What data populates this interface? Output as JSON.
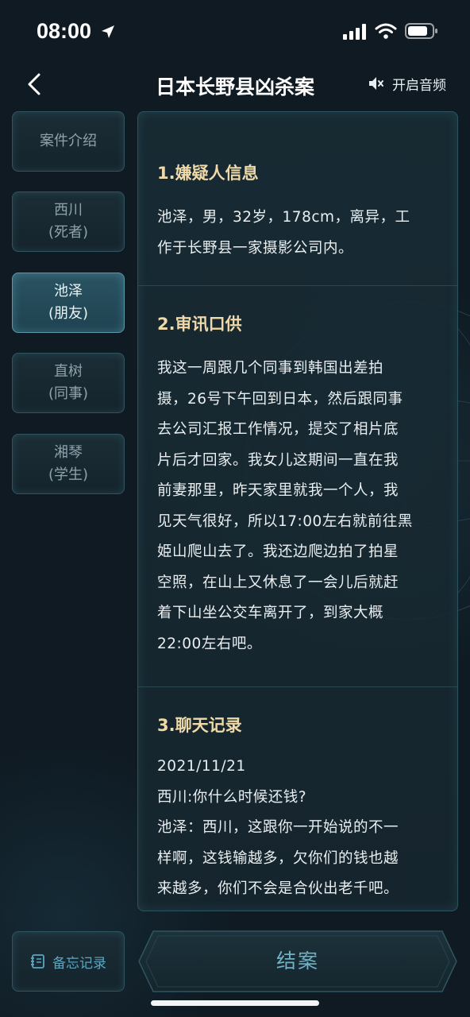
{
  "status_bar": {
    "time": "08:00"
  },
  "header": {
    "title": "日本长野县凶杀案",
    "audio_label": "开启音频"
  },
  "sidebar": {
    "items": [
      {
        "line1": "案件介绍",
        "line2": ""
      },
      {
        "line1": "西川",
        "line2": "(死者)"
      },
      {
        "line1": "池泽",
        "line2": "(朋友)"
      },
      {
        "line1": "直树",
        "line2": "(同事)"
      },
      {
        "line1": "湘琴",
        "line2": "(学生)"
      }
    ],
    "active_index": 2
  },
  "content": {
    "sections": [
      {
        "title": "1.嫌疑人信息",
        "lines": [
          "池泽，男，32岁，178cm，离异，工",
          "作于长野县一家摄影公司内。"
        ]
      },
      {
        "title": "2.审讯口供",
        "lines": [
          "我这一周跟几个同事到韩国出差拍",
          "摄，26号下午回到日本，然后跟同事",
          "去公司汇报工作情况，提交了相片底",
          "片后才回家。我女儿这期间一直在我",
          "前妻那里，昨天家里就我一个人，我",
          "见天气很好，所以17:00左右就前往黑",
          "姫山爬山去了。我还边爬边拍了拍星",
          "空照，在山上又休息了一会儿后就赶",
          "着下山坐公交车离开了，到家大概",
          "22:00左右吧。"
        ]
      },
      {
        "title": "3.聊天记录",
        "lines": [
          "2021/11/21",
          "西川:你什么时候还钱?",
          "池泽：西川，这跟你一开始说的不一",
          "样啊，这钱输越多，欠你们的钱也越",
          "来越多，你们不会是合伙出老千吧。"
        ]
      }
    ]
  },
  "bottom_bar": {
    "memo_label": "备忘记录",
    "close_case_label": "结案"
  },
  "colors": {
    "background": "#0f1a22",
    "section_title": "#efd9a8",
    "accent": "#6fb2c8",
    "active_tab": "#2a5362"
  }
}
